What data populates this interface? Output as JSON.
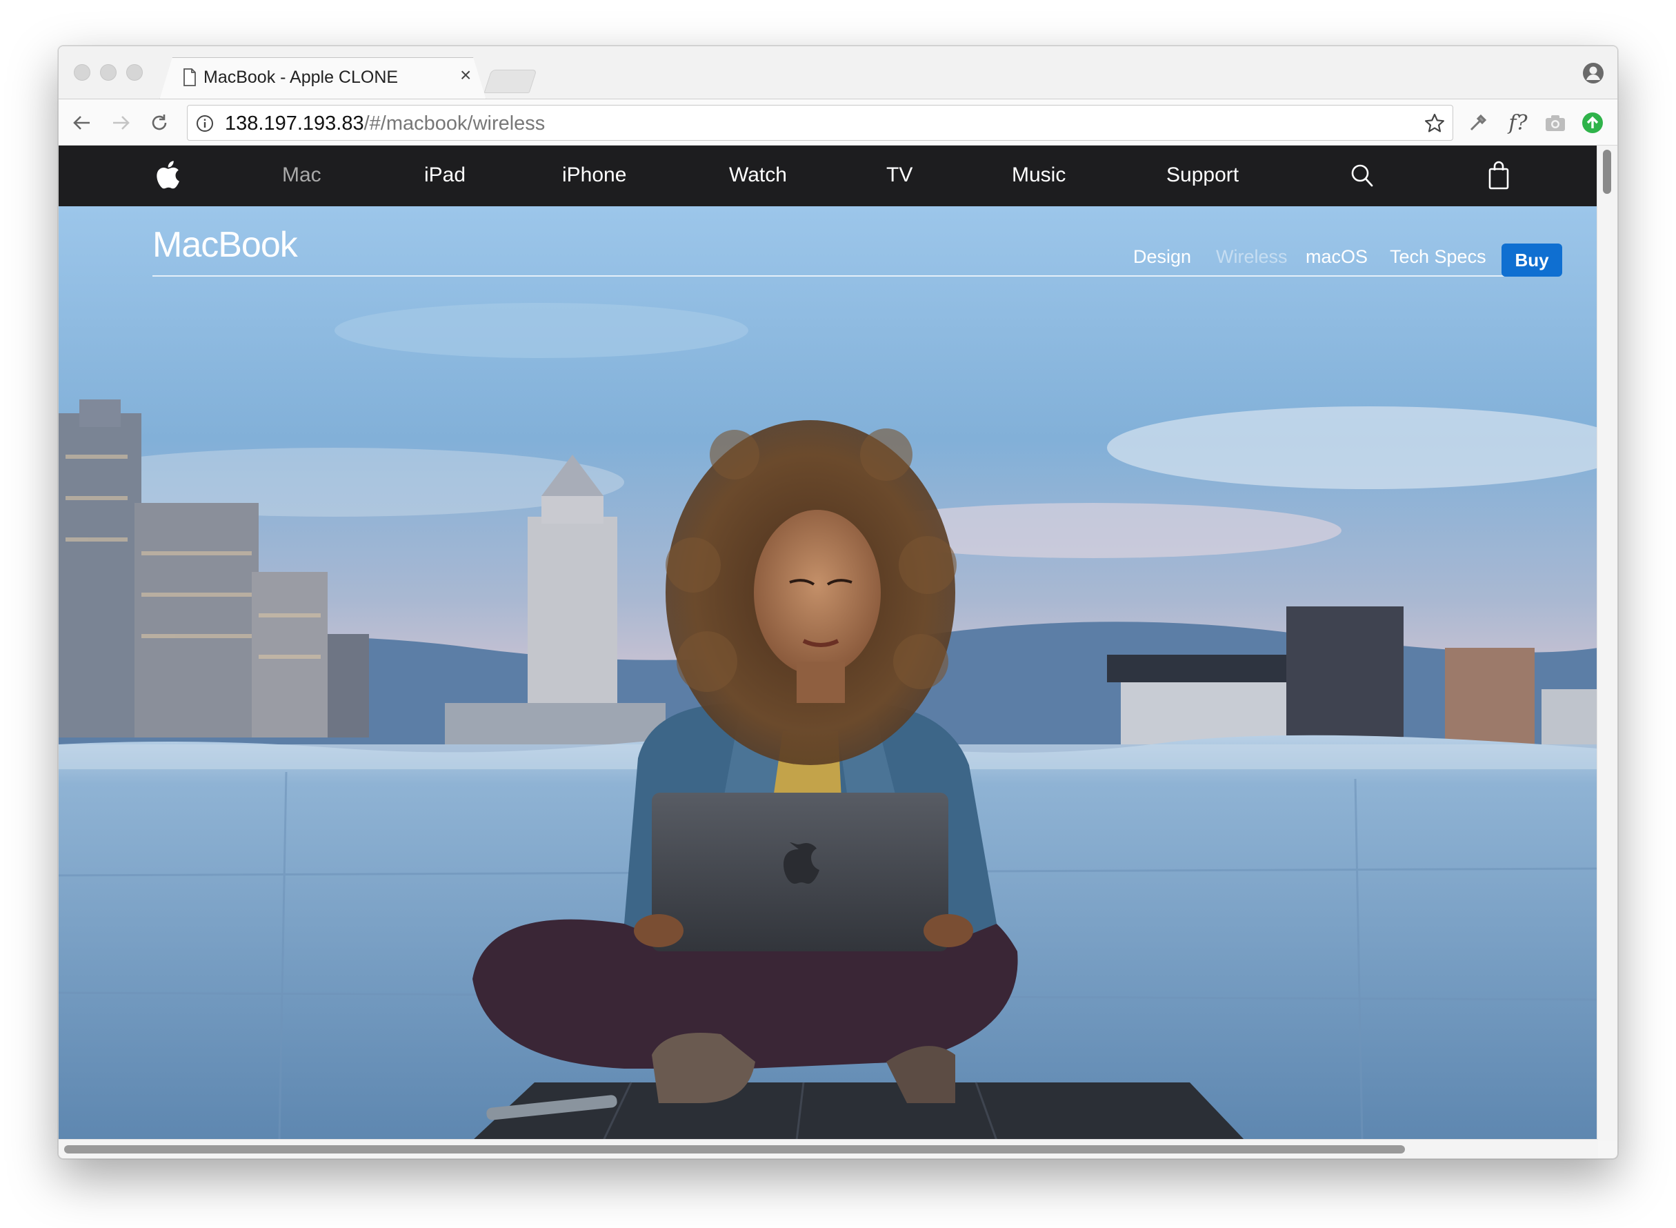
{
  "browser": {
    "tab_title": "MacBook - Apple CLONE",
    "tab_close": "×",
    "url_host": "138.197.193.83",
    "url_path": "/#/macbook/wireless",
    "extension_label": "f?"
  },
  "global_nav": {
    "items": [
      "Mac",
      "iPad",
      "iPhone",
      "Watch",
      "TV",
      "Music",
      "Support"
    ],
    "active": "Mac"
  },
  "local_nav": {
    "title": "MacBook",
    "links": [
      "Design",
      "Wireless",
      "macOS",
      "Tech Specs"
    ],
    "current": "Wireless",
    "buy_label": "Buy"
  },
  "colors": {
    "global_nav_bg": "#1d1d1f",
    "buy_button": "#0f6fd1",
    "hero_sky": "#8fbde3"
  },
  "icons": {
    "toolbar": [
      "back-arrow-icon",
      "forward-arrow-icon",
      "reload-icon",
      "info-icon",
      "star-icon",
      "eyedropper-icon",
      "camera-icon",
      "upload-icon"
    ],
    "global_nav": [
      "apple-logo-icon",
      "search-icon",
      "shopping-bag-icon"
    ]
  }
}
